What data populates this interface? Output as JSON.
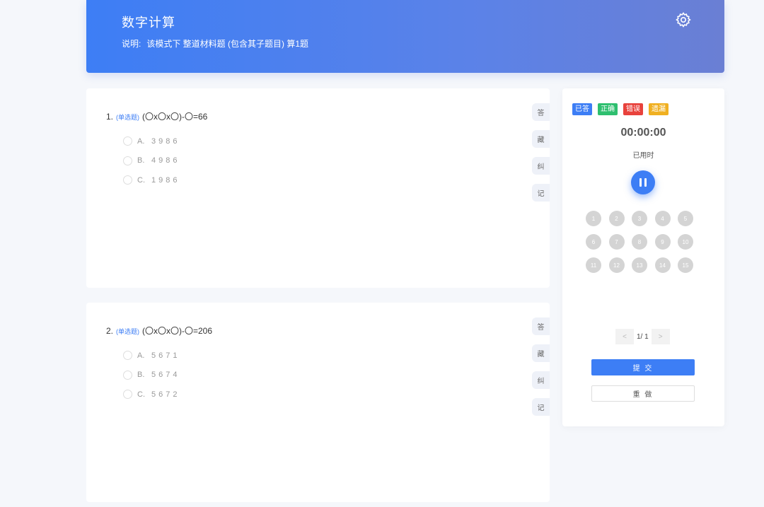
{
  "header": {
    "title": "数字计算",
    "desc_label": "说明:",
    "desc_text": "该模式下 整道材料题 (包含其子题目) 算1题"
  },
  "questions": [
    {
      "number": "1.",
      "type": "(单选题)",
      "stem": "(〇x〇x〇)-〇=66",
      "options": [
        {
          "letter": "A.",
          "value": "3986"
        },
        {
          "letter": "B.",
          "value": "4986"
        },
        {
          "letter": "C.",
          "value": "1986"
        }
      ]
    },
    {
      "number": "2.",
      "type": "(单选题)",
      "stem": "(〇x〇x〇)-〇=206",
      "options": [
        {
          "letter": "A.",
          "value": "5671"
        },
        {
          "letter": "B.",
          "value": "5674"
        },
        {
          "letter": "C.",
          "value": "5672"
        }
      ]
    }
  ],
  "side_tabs": [
    "答",
    "藏",
    "纠",
    "记"
  ],
  "panel": {
    "legend": [
      {
        "label": "已答",
        "color": "#3d7ef5"
      },
      {
        "label": "正确",
        "color": "#2ebf6f"
      },
      {
        "label": "错误",
        "color": "#e8423c"
      },
      {
        "label": "遗漏",
        "color": "#f0b021"
      }
    ],
    "timer": "00:00:00",
    "timer_label": "已用时",
    "numbers": [
      "1",
      "2",
      "3",
      "4",
      "5",
      "6",
      "7",
      "8",
      "9",
      "10",
      "11",
      "12",
      "13",
      "14",
      "15"
    ],
    "pager": {
      "prev": "<",
      "page": "1/ 1",
      "next": ">"
    },
    "submit_label": "提 交",
    "redo_label": "重 做"
  },
  "colors": {
    "accent": "#3d7ef5",
    "cell_bg": "#d4d4d4"
  }
}
